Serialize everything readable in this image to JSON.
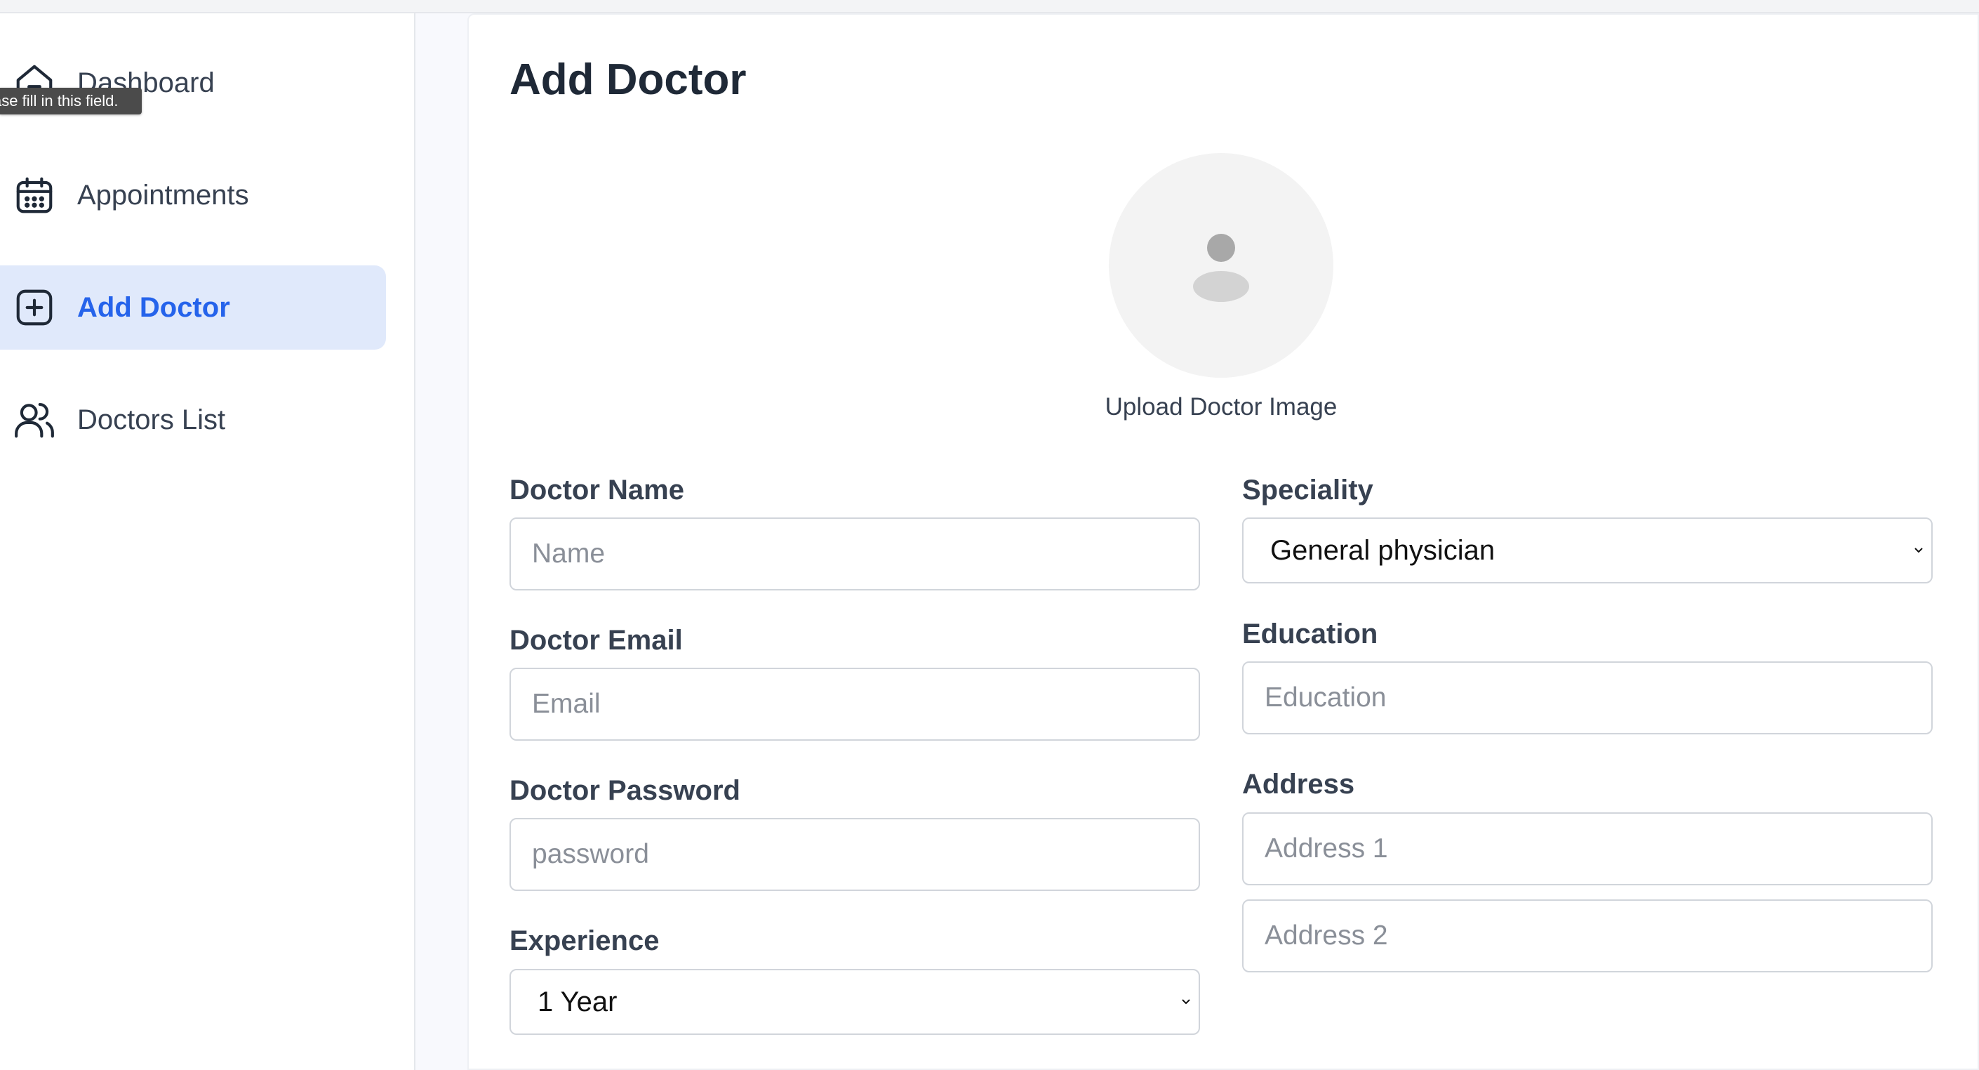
{
  "sidebar": {
    "items": [
      {
        "label": "Dashboard",
        "icon": "home-icon",
        "active": false
      },
      {
        "label": "Appointments",
        "icon": "calendar-icon",
        "active": false
      },
      {
        "label": "Add Doctor",
        "icon": "add-square-icon",
        "active": true
      },
      {
        "label": "Doctors List",
        "icon": "users-icon",
        "active": false
      }
    ],
    "tooltip": "ase fill in this field."
  },
  "main": {
    "title": "Add Doctor",
    "upload_label": "Upload Doctor Image",
    "avatar_icon": "user-placeholder-icon",
    "form": {
      "name": {
        "label": "Doctor Name",
        "placeholder": "Name",
        "value": ""
      },
      "email": {
        "label": "Doctor Email",
        "placeholder": "Email",
        "value": ""
      },
      "password": {
        "label": "Doctor Password",
        "placeholder": "password",
        "value": ""
      },
      "experience": {
        "label": "Experience",
        "selected": "1 Year"
      },
      "speciality": {
        "label": "Speciality",
        "selected": "General physician"
      },
      "education": {
        "label": "Education",
        "placeholder": "Education",
        "value": ""
      },
      "address": {
        "label": "Address",
        "line1_placeholder": "Address 1",
        "line2_placeholder": "Address 2"
      }
    }
  },
  "colors": {
    "accent": "#2563eb",
    "active_bg": "#e0e9fb",
    "text": "#1f2937"
  }
}
